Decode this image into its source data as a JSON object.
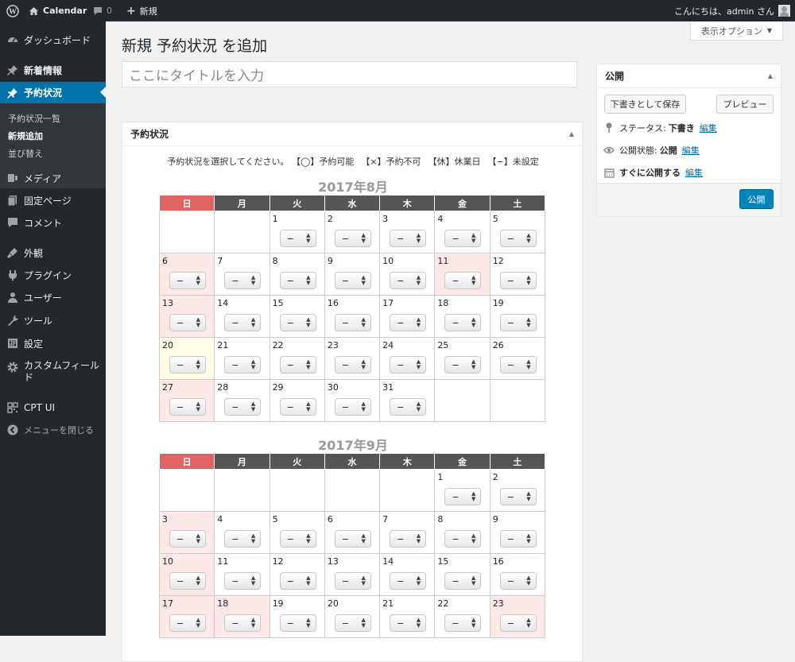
{
  "adminbar": {
    "site_name": "Calendar",
    "comments_count": "0",
    "new_label": "新規",
    "greeting": "こんにちは、admin さん"
  },
  "sidebar": {
    "items": [
      {
        "label": "ダッシュボード",
        "icon": "dashboard-icon"
      },
      {
        "label": "新着情報",
        "icon": "pin-icon"
      },
      {
        "label": "予約状況",
        "icon": "pin-icon"
      },
      {
        "label": "メディア",
        "icon": "media-icon"
      },
      {
        "label": "固定ページ",
        "icon": "page-icon"
      },
      {
        "label": "コメント",
        "icon": "comment-icon"
      },
      {
        "label": "外観",
        "icon": "appearance-icon"
      },
      {
        "label": "プラグイン",
        "icon": "plugin-icon"
      },
      {
        "label": "ユーザー",
        "icon": "user-icon"
      },
      {
        "label": "ツール",
        "icon": "wrench-icon"
      },
      {
        "label": "設定",
        "icon": "settings-icon"
      },
      {
        "label": "カスタムフィールド",
        "icon": "gear-icon"
      },
      {
        "label": "CPT UI",
        "icon": "cptui-icon"
      },
      {
        "label": "メニューを閉じる",
        "icon": "collapse-icon"
      }
    ],
    "submenu": [
      "予約状況一覧",
      "新規追加",
      "並び替え"
    ]
  },
  "main": {
    "screen_options": "表示オプション",
    "page_title": "新規 予約状況 を追加",
    "title_placeholder": "ここにタイトルを入力"
  },
  "status_box": {
    "title": "予約状況",
    "legend": "予約状況を選択してください。 【◯】予約可能 　【×】予約不可 　【休】休業日 　【−】未設定",
    "weekdays": [
      "日",
      "月",
      "火",
      "水",
      "木",
      "金",
      "土"
    ],
    "select_value": "−",
    "months": [
      {
        "title": "2017年8月",
        "weeks": [
          [
            "",
            "",
            "1",
            "2",
            "3",
            "4",
            "5"
          ],
          [
            "6",
            "7",
            "8",
            "9",
            "10",
            "11",
            "12"
          ],
          [
            "13",
            "14",
            "15",
            "16",
            "17",
            "18",
            "19"
          ],
          [
            "20",
            "21",
            "22",
            "23",
            "24",
            "25",
            "26"
          ],
          [
            "27",
            "28",
            "29",
            "30",
            "31",
            "",
            ""
          ]
        ],
        "holidays": [
          "6",
          "11",
          "13",
          "27"
        ],
        "today": "20"
      },
      {
        "title": "2017年9月",
        "weeks": [
          [
            "",
            "",
            "",
            "",
            "",
            "1",
            "2"
          ],
          [
            "3",
            "4",
            "5",
            "6",
            "7",
            "8",
            "9"
          ],
          [
            "10",
            "11",
            "12",
            "13",
            "14",
            "15",
            "16"
          ],
          [
            "17",
            "18",
            "19",
            "20",
            "21",
            "22",
            "23"
          ]
        ],
        "holidays": [
          "3",
          "10",
          "17",
          "18",
          "23"
        ],
        "today": ""
      }
    ]
  },
  "publish_box": {
    "title": "公開",
    "save_draft": "下書きとして保存",
    "preview": "プレビュー",
    "status_label": "ステータス:",
    "status_value": "下書き",
    "visibility_label": "公開状態:",
    "visibility_value": "公開",
    "schedule_label": "すぐに公開する",
    "edit_link": "編集",
    "publish_button": "公開"
  }
}
